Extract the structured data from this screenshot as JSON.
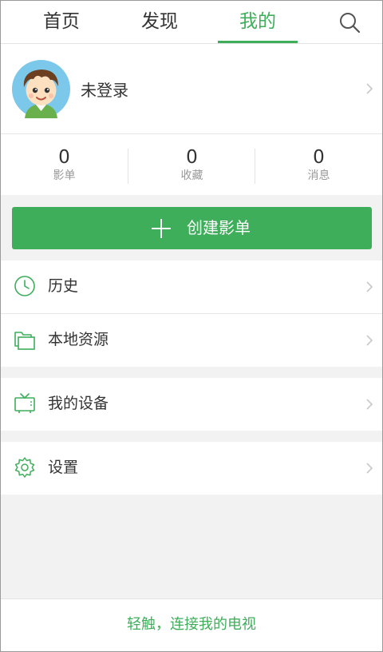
{
  "colors": {
    "accent": "#3fae5b",
    "divider": "#e6e6e6",
    "page_bg": "#f2f2f2",
    "muted_text": "#999999"
  },
  "tabs": [
    {
      "label": "首页",
      "active": false
    },
    {
      "label": "发现",
      "active": false
    },
    {
      "label": "我的",
      "active": true
    }
  ],
  "icons": {
    "search": "search-icon",
    "avatar": "cartoon-boy-avatar",
    "history": "clock-icon",
    "local": "folder-icon",
    "devices": "tv-icon",
    "settings": "gear-icon",
    "chevron": "chevron-right-icon",
    "plus": "plus-icon"
  },
  "profile": {
    "name": "未登录"
  },
  "stats": [
    {
      "value": "0",
      "label": "影单"
    },
    {
      "value": "0",
      "label": "收藏"
    },
    {
      "value": "0",
      "label": "消息"
    }
  ],
  "create_button": {
    "label": "创建影单"
  },
  "menu": {
    "history": "历史",
    "local": "本地资源",
    "devices": "我的设备",
    "settings": "设置"
  },
  "bottom": {
    "label": "轻触，连接我的电视"
  }
}
